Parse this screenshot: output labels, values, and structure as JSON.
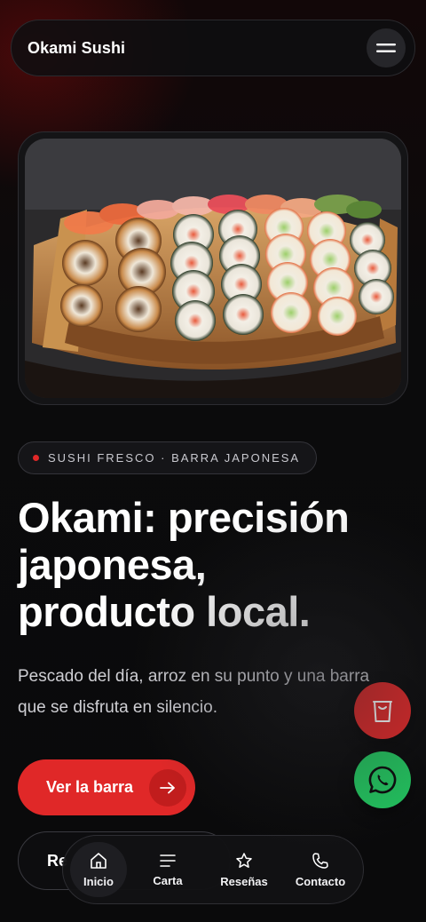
{
  "header": {
    "brand": "Okami Sushi",
    "menu_icon": "hamburger-menu-icon"
  },
  "hero": {
    "image_subject": "sushi boat platter"
  },
  "tag": {
    "label": "SUSHI FRESCO · BARRA JAPONESA",
    "dot_color": "#e02828"
  },
  "headline": {
    "line1": "Okami: precisión",
    "line2": "japonesa,",
    "line3": "producto local."
  },
  "subtext": {
    "line1": "Pescado del día, arroz en su punto y una barra",
    "line2": "que se disfruta en silencio."
  },
  "cta_primary": {
    "label": "Ver la barra",
    "icon": "arrow-right-icon"
  },
  "cta_secondary": {
    "label": "Re"
  },
  "fabs": {
    "order_icon": "takeaway-cup-icon",
    "whatsapp_icon": "whatsapp-icon"
  },
  "bottom_nav": {
    "items": [
      {
        "label": "Inicio",
        "icon": "home-icon",
        "active": true
      },
      {
        "label": "Carta",
        "icon": "menu-list-icon"
      },
      {
        "label": "Reseñas",
        "icon": "star-icon"
      },
      {
        "label": "Contacto",
        "icon": "phone-icon"
      }
    ]
  },
  "colors": {
    "accent": "#e02828",
    "whatsapp": "#22c35e",
    "background": "#0a0a0b"
  }
}
